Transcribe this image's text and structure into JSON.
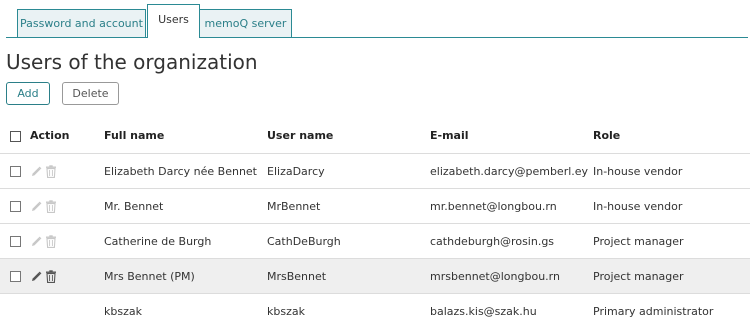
{
  "tabs": [
    {
      "label": "Password and account",
      "active": false
    },
    {
      "label": "Users",
      "active": true
    },
    {
      "label": "memoQ server",
      "active": false
    }
  ],
  "page_title": "Users of the organization",
  "toolbar": {
    "add_label": "Add",
    "delete_label": "Delete"
  },
  "table": {
    "headers": {
      "action": "Action",
      "full_name": "Full name",
      "user_name": "User name",
      "email": "E-mail",
      "role": "Role"
    },
    "rows": [
      {
        "full_name": "Elizabeth Darcy née Bennet",
        "user_name": "ElizaDarcy",
        "email": "elizabeth.darcy@pemberl.ey",
        "role": "In-house vendor",
        "selectable": true,
        "actions_enabled": false
      },
      {
        "full_name": "Mr. Bennet",
        "user_name": "MrBennet",
        "email": "mr.bennet@longbou.rn",
        "role": "In-house vendor",
        "selectable": true,
        "actions_enabled": false
      },
      {
        "full_name": "Catherine de Burgh",
        "user_name": "CathDeBurgh",
        "email": "cathdeburgh@rosin.gs",
        "role": "Project manager",
        "selectable": true,
        "actions_enabled": false
      },
      {
        "full_name": "Mrs Bennet (PM)",
        "user_name": "MrsBennet",
        "email": "mrsbennet@longbou.rn",
        "role": "Project manager",
        "selectable": true,
        "actions_enabled": true,
        "highlighted": true
      },
      {
        "full_name": "kbszak",
        "user_name": "kbszak",
        "email": "balazs.kis@szak.hu",
        "role": "Primary administrator",
        "selectable": false,
        "actions_enabled": false
      }
    ]
  },
  "colors": {
    "accent": "#2b8a94",
    "tab_inactive_bg": "#eaf2f4",
    "row_highlight": "#efefef",
    "icon_disabled": "#c8c8c8",
    "icon_enabled": "#555555"
  },
  "icons": {
    "edit": "pencil-icon",
    "delete": "trash-icon"
  }
}
